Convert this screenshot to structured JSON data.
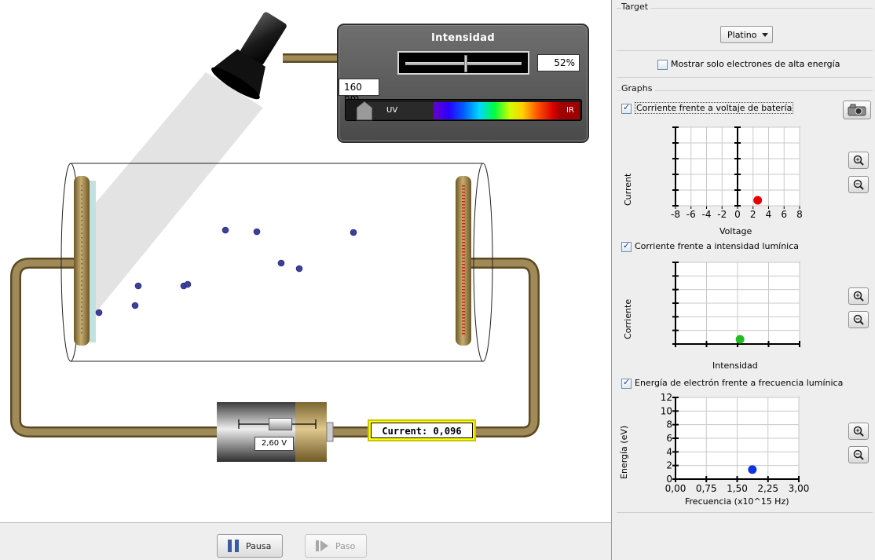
{
  "simulation": {
    "intensity_panel": {
      "title": "Intensidad",
      "intensity_value": "52%",
      "intensity_level": 0.52,
      "wavelength": "160 nm",
      "spectrum_uv_label": "UV",
      "spectrum_ir_label": "IR"
    },
    "battery_voltage": "2,60 V",
    "current_readout": "Current:  0,096"
  },
  "controls": {
    "pause_label": "Pausa",
    "step_label": "Paso"
  },
  "panel": {
    "target": {
      "title": "Target",
      "selected": "Platino"
    },
    "high_energy_checkbox": {
      "label": "Mostrar solo electrones de alta energía",
      "checked": false
    },
    "graphs": {
      "title": "Graphs",
      "current_vs_voltage": {
        "label": "Corriente frente a voltaje de batería",
        "checked": true,
        "y_axis_title": "Current",
        "x_axis_title": "Voltage",
        "x_ticks": [
          "-8",
          "-6",
          "-4",
          "-2",
          "0",
          "2",
          "4",
          "6",
          "8"
        ],
        "xlim": [
          -8,
          8
        ],
        "point": {
          "x": 2.6,
          "color": "#e60000"
        }
      },
      "current_vs_intensity": {
        "label": "Corriente frente a intensidad lumínica",
        "checked": true,
        "y_axis_title": "Corriente",
        "x_axis_title": "Intensidad",
        "xlim": [
          0,
          100
        ],
        "point": {
          "x": 52,
          "color": "#22bb22"
        }
      },
      "energy_vs_frequency": {
        "label": "Energía de electrón frente a frecuencia lumínica",
        "checked": true,
        "y_axis_title": "Energía (eV)",
        "x_axis_title": "Frecuencia (x10^15 Hz)",
        "x_ticks": [
          "0,00",
          "0,75",
          "1,50",
          "2,25",
          "3,00"
        ],
        "y_ticks": [
          "0",
          "2",
          "4",
          "6",
          "8",
          "10",
          "12"
        ],
        "xlim": [
          0,
          3
        ],
        "ylim": [
          0,
          12
        ],
        "point": {
          "x": 1.87,
          "y": 1.4,
          "color": "#1133dd"
        }
      }
    }
  }
}
